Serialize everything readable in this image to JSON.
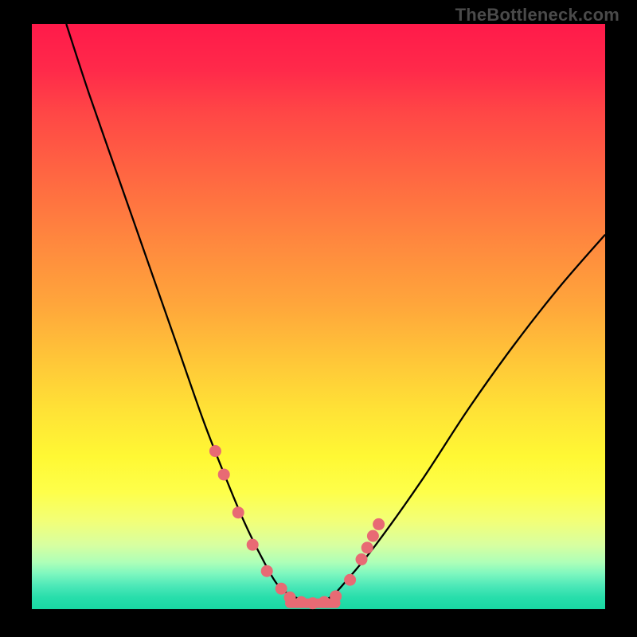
{
  "watermark": "TheBottleneck.com",
  "chart_data": {
    "type": "line",
    "title": "",
    "xlabel": "",
    "ylabel": "",
    "xlim": [
      0,
      100
    ],
    "ylim": [
      0,
      100
    ],
    "series": [
      {
        "name": "curve",
        "x": [
          6,
          10,
          15,
          20,
          25,
          30,
          34,
          37,
          40,
          43,
          46,
          49,
          52,
          55,
          60,
          68,
          76,
          84,
          92,
          100
        ],
        "values": [
          100,
          88,
          74,
          60,
          46,
          32,
          22,
          15,
          9,
          4,
          2,
          1,
          2,
          5,
          11,
          22,
          34,
          45,
          55,
          64
        ]
      }
    ],
    "markers": {
      "name": "highlighted-points",
      "color": "#e86a74",
      "x": [
        32,
        33.5,
        36,
        38.5,
        41,
        43.5,
        45,
        47,
        49,
        51,
        53,
        55.5,
        57.5,
        58.5,
        59.5,
        60.5
      ],
      "values": [
        27,
        23,
        16.5,
        11,
        6.5,
        3.5,
        2,
        1.2,
        1,
        1.2,
        2.2,
        5,
        8.5,
        10.5,
        12.5,
        14.5
      ]
    },
    "flat_band": {
      "x_start": 45,
      "x_end": 53,
      "y": 1,
      "color": "#e86a74"
    }
  }
}
